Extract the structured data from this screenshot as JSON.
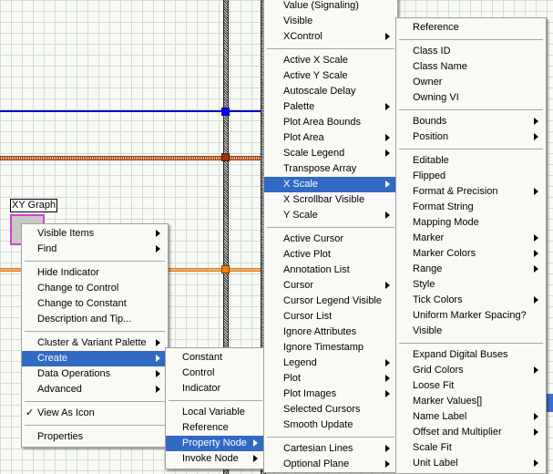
{
  "diagram": {
    "node_label": "XY Graph",
    "wire_colors": {
      "blue": "#0000c8",
      "brown": "#a04010",
      "orange": "#e07a10"
    }
  },
  "context_menu": {
    "items": [
      {
        "label": "Visible Items",
        "submenu": true
      },
      {
        "label": "Find",
        "submenu": true
      },
      {
        "sep": true
      },
      {
        "label": "Hide Indicator"
      },
      {
        "label": "Change to Control"
      },
      {
        "label": "Change to Constant"
      },
      {
        "label": "Description and Tip..."
      },
      {
        "sep": true
      },
      {
        "label": "Cluster & Variant Palette",
        "submenu": true
      },
      {
        "label": "Create",
        "submenu": true,
        "highlighted": true
      },
      {
        "label": "Data Operations",
        "submenu": true
      },
      {
        "label": "Advanced",
        "submenu": true
      },
      {
        "sep": true
      },
      {
        "label": "View As Icon",
        "checked": true
      },
      {
        "sep": true
      },
      {
        "label": "Properties"
      }
    ]
  },
  "create_menu": {
    "items": [
      {
        "label": "Constant"
      },
      {
        "label": "Control"
      },
      {
        "label": "Indicator"
      },
      {
        "sep": true
      },
      {
        "label": "Local Variable"
      },
      {
        "label": "Reference"
      },
      {
        "label": "Property Node",
        "submenu": true,
        "highlighted": true
      },
      {
        "label": "Invoke Node",
        "submenu": true
      }
    ]
  },
  "property_menu": {
    "items": [
      {
        "label": "Value (Signaling)"
      },
      {
        "label": "Visible"
      },
      {
        "label": "XControl",
        "submenu": true
      },
      {
        "sep": true
      },
      {
        "label": "Active X Scale"
      },
      {
        "label": "Active Y Scale"
      },
      {
        "label": "Autoscale Delay"
      },
      {
        "label": "Palette",
        "submenu": true
      },
      {
        "label": "Plot Area Bounds"
      },
      {
        "label": "Plot Area",
        "submenu": true
      },
      {
        "label": "Scale Legend",
        "submenu": true
      },
      {
        "label": "Transpose Array"
      },
      {
        "label": "X Scale",
        "submenu": true,
        "highlighted": true
      },
      {
        "label": "X Scrollbar Visible"
      },
      {
        "label": "Y Scale",
        "submenu": true
      },
      {
        "sep": true
      },
      {
        "label": "Active Cursor"
      },
      {
        "label": "Active Plot"
      },
      {
        "label": "Annotation List"
      },
      {
        "label": "Cursor",
        "submenu": true
      },
      {
        "label": "Cursor Legend Visible"
      },
      {
        "label": "Cursor List"
      },
      {
        "label": "Ignore Attributes"
      },
      {
        "label": "Ignore Timestamp"
      },
      {
        "label": "Legend",
        "submenu": true
      },
      {
        "label": "Plot",
        "submenu": true
      },
      {
        "label": "Plot Images",
        "submenu": true
      },
      {
        "label": "Selected Cursors"
      },
      {
        "label": "Smooth Update"
      },
      {
        "sep": true
      },
      {
        "label": "Cartesian Lines",
        "submenu": true
      },
      {
        "label": "Optional Plane",
        "submenu": true
      }
    ]
  },
  "xscale_menu": {
    "items": [
      {
        "label": "Reference"
      },
      {
        "sep": true
      },
      {
        "label": "Class ID"
      },
      {
        "label": "Class Name"
      },
      {
        "label": "Owner"
      },
      {
        "label": "Owning VI"
      },
      {
        "sep": true
      },
      {
        "label": "Bounds",
        "submenu": true
      },
      {
        "label": "Position",
        "submenu": true
      },
      {
        "sep": true
      },
      {
        "label": "Editable"
      },
      {
        "label": "Flipped"
      },
      {
        "label": "Format & Precision",
        "submenu": true
      },
      {
        "label": "Format String"
      },
      {
        "label": "Mapping Mode"
      },
      {
        "label": "Marker",
        "submenu": true
      },
      {
        "label": "Marker Colors",
        "submenu": true
      },
      {
        "label": "Range",
        "submenu": true
      },
      {
        "label": "Style"
      },
      {
        "label": "Tick Colors",
        "submenu": true
      },
      {
        "label": "Uniform Marker Spacing?"
      },
      {
        "label": "Visible"
      },
      {
        "sep": true
      },
      {
        "label": "Expand Digital Buses"
      },
      {
        "label": "Grid Colors",
        "submenu": true
      },
      {
        "label": "Loose Fit"
      },
      {
        "label": "Marker Values[]"
      },
      {
        "label": "Name Label",
        "submenu": true
      },
      {
        "label": "Offset and Multiplier",
        "submenu": true
      },
      {
        "label": "Scale Fit"
      },
      {
        "label": "Unit Label",
        "submenu": true
      }
    ]
  }
}
